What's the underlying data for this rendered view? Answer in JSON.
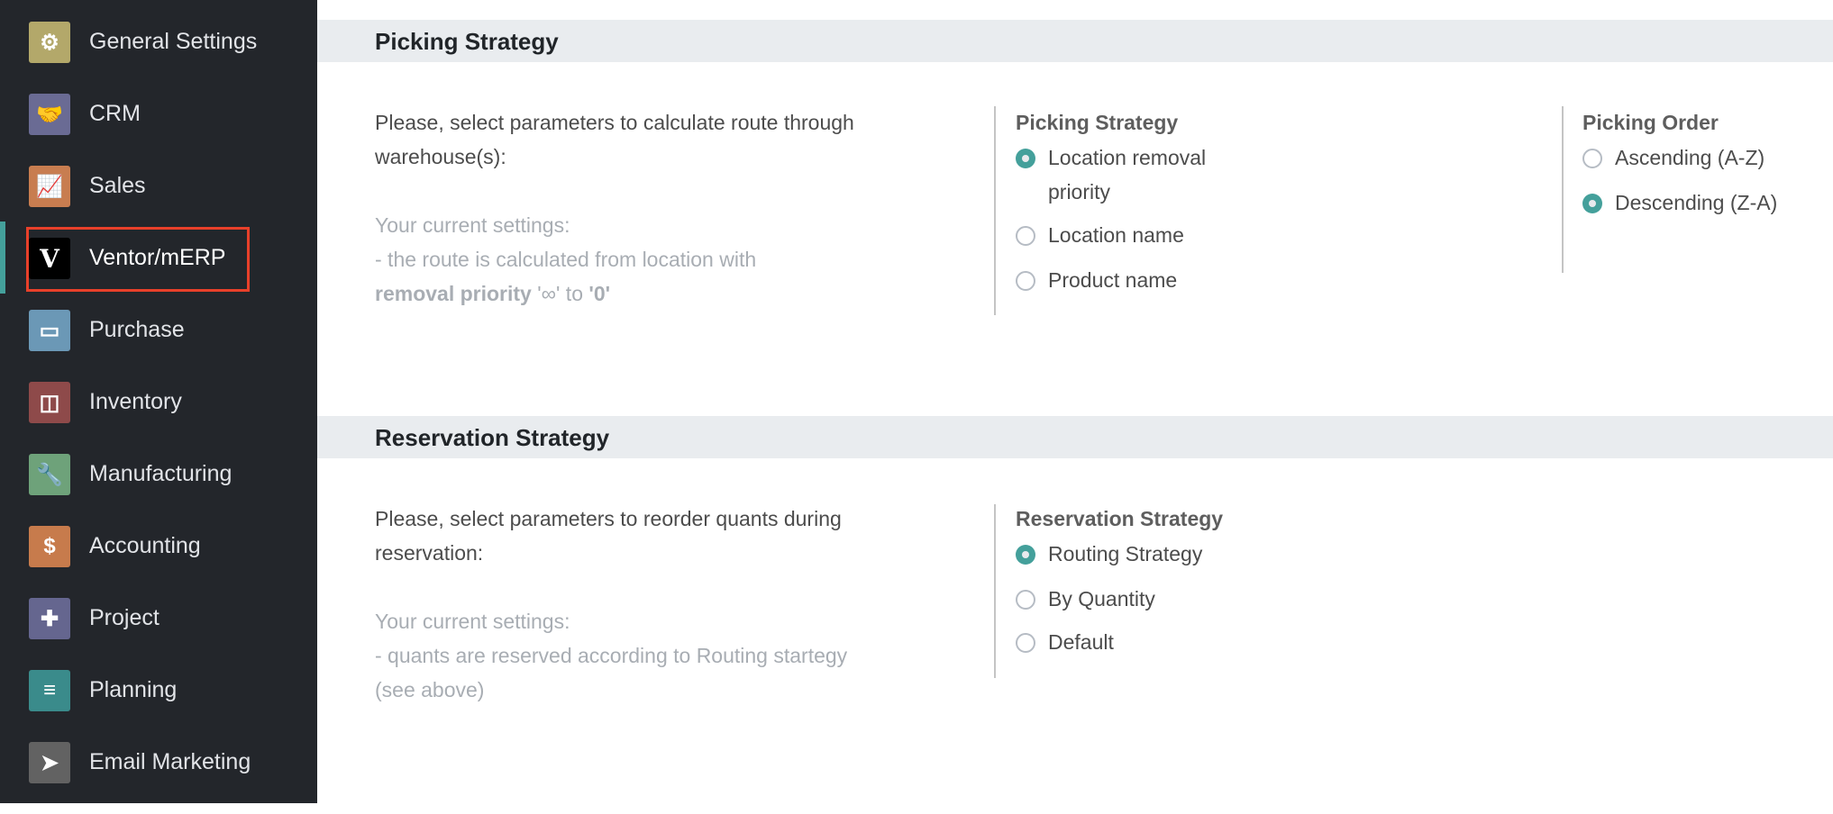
{
  "sidebar": {
    "items": [
      {
        "label": "General Settings",
        "icon": "gear-icon",
        "color": "#b3a86a",
        "glyph": "⚙"
      },
      {
        "label": "CRM",
        "icon": "handshake-icon",
        "color": "#6a6b94",
        "glyph": "🤝"
      },
      {
        "label": "Sales",
        "icon": "chart-icon",
        "color": "#c87d50",
        "glyph": "📈"
      },
      {
        "label": "Ventor/mERP",
        "icon": "ventor-logo-icon",
        "color": "#000000",
        "glyph": "V"
      },
      {
        "label": "Purchase",
        "icon": "credit-card-icon",
        "color": "#6b98b6",
        "glyph": "▭"
      },
      {
        "label": "Inventory",
        "icon": "box-icon",
        "color": "#8e4a4a",
        "glyph": "◫"
      },
      {
        "label": "Manufacturing",
        "icon": "wrench-icon",
        "color": "#6ea27a",
        "glyph": "🔧"
      },
      {
        "label": "Accounting",
        "icon": "invoice-icon",
        "color": "#c77b4c",
        "glyph": "$"
      },
      {
        "label": "Project",
        "icon": "puzzle-icon",
        "color": "#65668f",
        "glyph": "✚"
      },
      {
        "label": "Planning",
        "icon": "planning-icon",
        "color": "#3a8b8b",
        "glyph": "≡"
      },
      {
        "label": "Email Marketing",
        "icon": "paper-plane-icon",
        "color": "#626262",
        "glyph": "➤"
      }
    ],
    "active": "Ventor/mERP"
  },
  "picking": {
    "title": "Picking Strategy",
    "intro": "Please, select parameters to calculate route through warehouse(s):",
    "current_label": "Your current settings:",
    "current_line": "- the route is calculated from location with",
    "current_bold": "removal priority",
    "current_from": "'∞'",
    "current_to_word": " to ",
    "current_to": "'0'",
    "strategy_label": "Picking Strategy",
    "strategy_options": [
      "Location removal priority",
      "Location name",
      "Product name"
    ],
    "strategy_selected": 0,
    "order_label": "Picking Order",
    "order_options": [
      "Ascending (A-Z)",
      "Descending (Z-A)"
    ],
    "order_selected": 1
  },
  "reservation": {
    "title": "Reservation Strategy",
    "intro": "Please, select parameters to reorder quants during reservation:",
    "current_label": "Your current settings:",
    "current_line": "- quants are reserved according to Routing startegy (see above)",
    "strategy_label": "Reservation Strategy",
    "strategy_options": [
      "Routing Strategy",
      "By Quantity",
      "Default"
    ],
    "strategy_selected": 0
  },
  "colors": {
    "accent": "#44a09b",
    "highlight": "#e8402a",
    "sidebar_bg": "#23262b"
  }
}
